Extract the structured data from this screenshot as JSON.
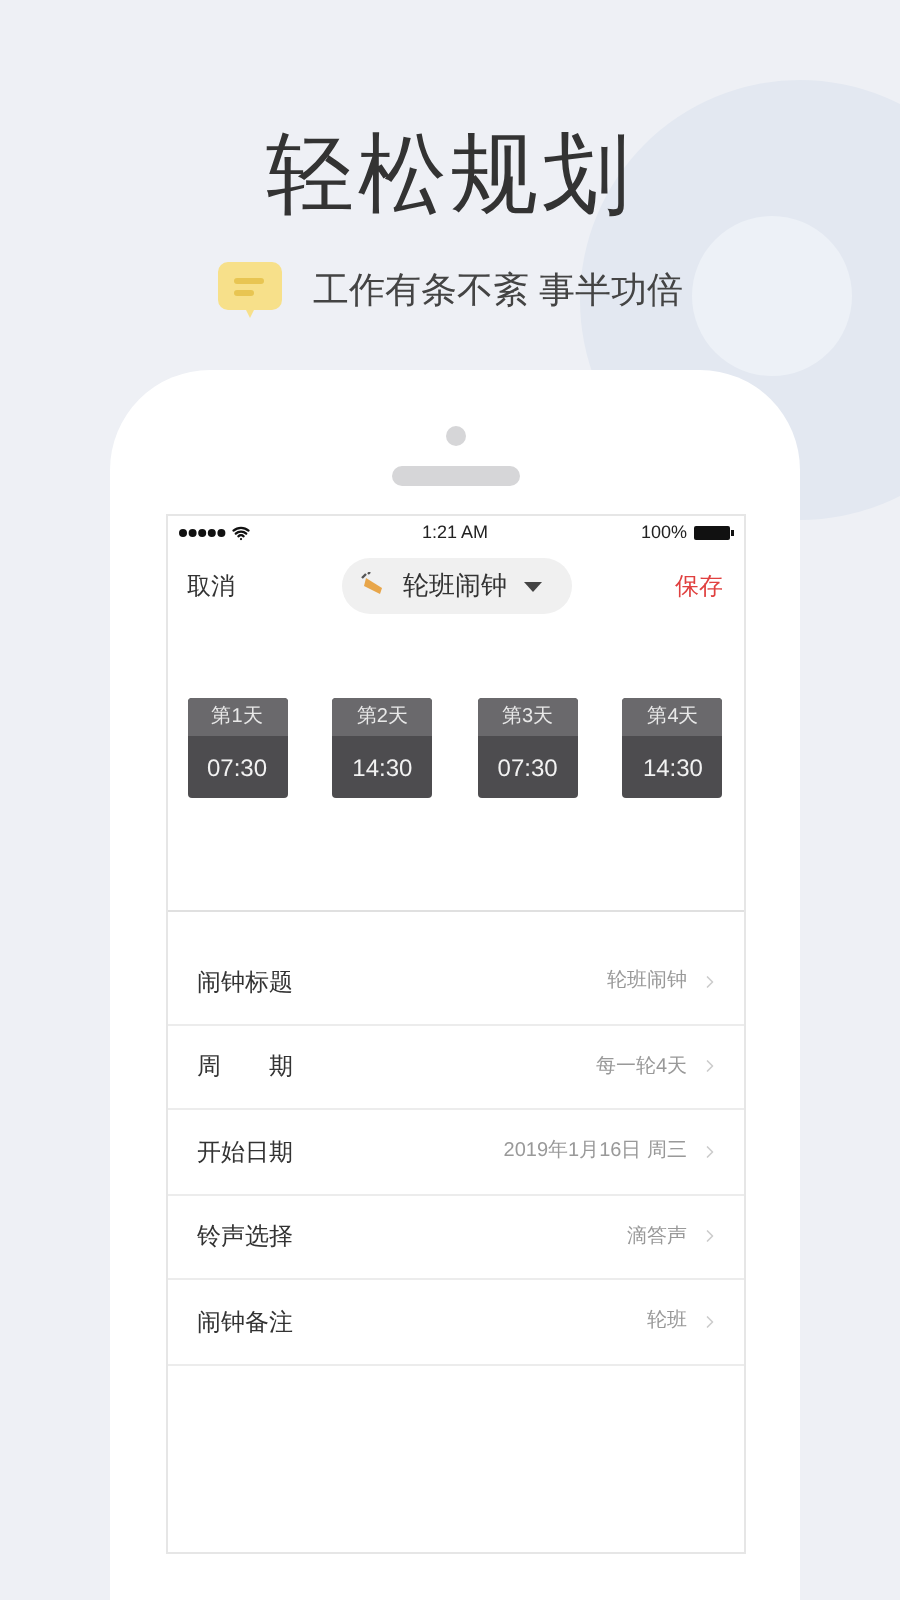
{
  "headline": "轻松规划",
  "subtitle": "工作有条不紊 事半功倍",
  "status_bar": {
    "time": "1:21 AM",
    "battery": "100%"
  },
  "nav": {
    "cancel": "取消",
    "title": "轮班闹钟",
    "save": "保存"
  },
  "days": [
    {
      "label": "第1天",
      "time": "07:30"
    },
    {
      "label": "第2天",
      "time": "14:30"
    },
    {
      "label": "第3天",
      "time": "07:30"
    },
    {
      "label": "第4天",
      "time": "14:30"
    }
  ],
  "rows": [
    {
      "label": "闹钟标题",
      "value": "轮班闹钟"
    },
    {
      "label": "周　　期",
      "value": "每一轮4天"
    },
    {
      "label": "开始日期",
      "value": "2019年1月16日 周三"
    },
    {
      "label": "铃声选择",
      "value": "滴答声"
    },
    {
      "label": "闹钟备注",
      "value": "轮班"
    }
  ]
}
